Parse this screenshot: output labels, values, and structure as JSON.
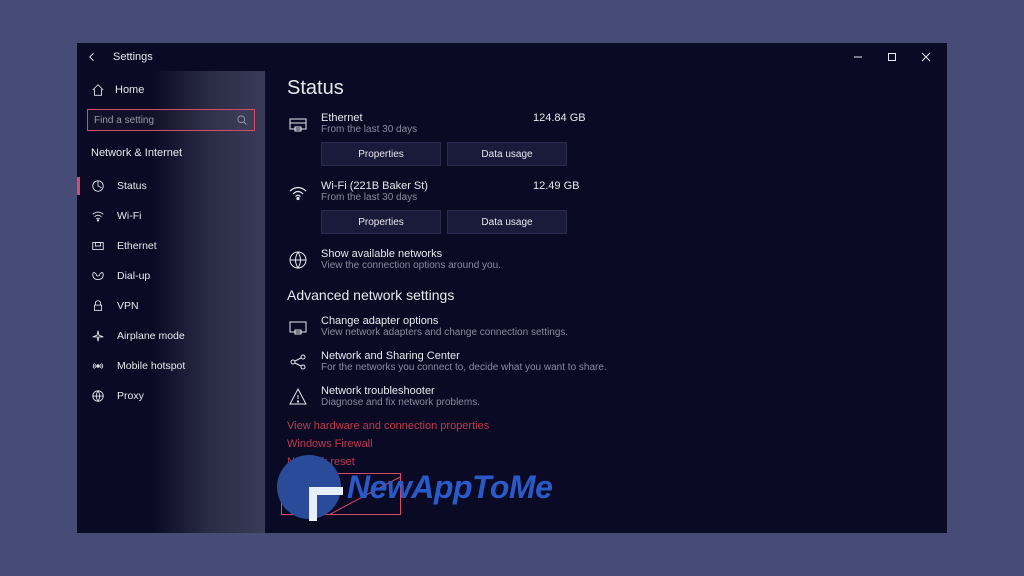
{
  "window": {
    "title": "Settings"
  },
  "sidebar": {
    "home_label": "Home",
    "search_placeholder": "Find a setting",
    "section_label": "Network & Internet",
    "items": [
      {
        "label": "Status",
        "icon": "status-icon",
        "active": true
      },
      {
        "label": "Wi-Fi",
        "icon": "wifi-icon"
      },
      {
        "label": "Ethernet",
        "icon": "ethernet-icon"
      },
      {
        "label": "Dial-up",
        "icon": "dialup-icon"
      },
      {
        "label": "VPN",
        "icon": "vpn-icon"
      },
      {
        "label": "Airplane mode",
        "icon": "airplane-icon"
      },
      {
        "label": "Mobile hotspot",
        "icon": "hotspot-icon"
      },
      {
        "label": "Proxy",
        "icon": "proxy-icon"
      }
    ]
  },
  "main": {
    "heading": "Status",
    "connections": [
      {
        "name": "Ethernet",
        "sub": "From the last 30 days",
        "value": "124.84 GB"
      },
      {
        "name": "Wi-Fi (221B Baker St)",
        "sub": "From the last 30 days",
        "value": "12.49 GB"
      }
    ],
    "btn_properties": "Properties",
    "btn_data_usage": "Data usage",
    "available": {
      "title": "Show available networks",
      "sub": "View the connection options around you."
    },
    "advanced_heading": "Advanced network settings",
    "advanced_items": [
      {
        "title": "Change adapter options",
        "sub": "View network adapters and change connection settings."
      },
      {
        "title": "Network and Sharing Center",
        "sub": "For the networks you connect to, decide what you want to share."
      },
      {
        "title": "Network troubleshooter",
        "sub": "Diagnose and fix network problems."
      }
    ],
    "links": [
      "View hardware and connection properties",
      "Windows Firewall",
      "Network reset"
    ]
  },
  "watermark": "NewAppToMe"
}
